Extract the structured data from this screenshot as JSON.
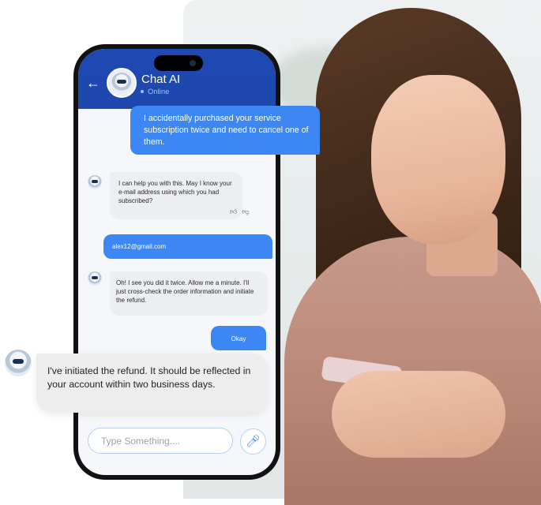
{
  "header": {
    "back_icon": "arrow-left-icon",
    "title": "Chat AI",
    "status": "Online"
  },
  "messages": [
    {
      "from": "user",
      "text": "I accidentally purchased your service subscription twice and need to cancel one of them."
    },
    {
      "from": "bot",
      "text": "I can help you with this. May I know your e-mail address using which you had subscribed?"
    },
    {
      "from": "user",
      "text": "alex12@gmail.com"
    },
    {
      "from": "bot",
      "text": "Oh! I see you did it twice. Allow me a minute. I'll just cross-check the order information and initiate the refund."
    },
    {
      "from": "user",
      "text": "Okay"
    },
    {
      "from": "bot",
      "text": "I've initiated the refund. It should be reflected in your account within two business days."
    }
  ],
  "composer": {
    "placeholder": "Type Something....",
    "mic_icon": "microphone-icon"
  },
  "colors": {
    "header": "#1E48AD",
    "user_bubble": "#3D87F5",
    "bot_bubble": "#ECEEF1",
    "status": "#9FC0FF"
  }
}
